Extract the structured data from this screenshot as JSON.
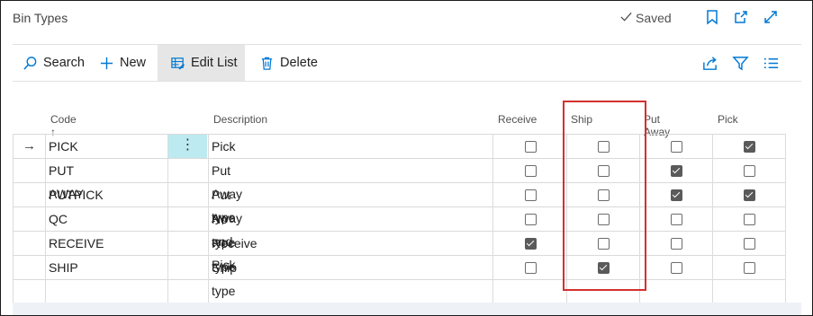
{
  "header": {
    "title": "Bin Types",
    "saved_label": "Saved"
  },
  "actions": {
    "search": "Search",
    "new": "New",
    "edit_list": "Edit List",
    "delete": "Delete"
  },
  "columns": {
    "code": "Code",
    "description": "Description",
    "receive": "Receive",
    "ship": "Ship",
    "put_away": "Put Away",
    "pick": "Pick"
  },
  "sort_indicator": "↑",
  "row_menu": "⋮",
  "current_row_marker": "→",
  "rows": [
    {
      "code": "PICK",
      "description": "Pick",
      "receive": false,
      "ship": false,
      "put_away": false,
      "pick": true
    },
    {
      "code": "PUT AWAY",
      "description": "Put Away type",
      "receive": false,
      "ship": false,
      "put_away": true,
      "pick": false
    },
    {
      "code": "PUTPICK",
      "description": "Put Away and Pick",
      "receive": false,
      "ship": false,
      "put_away": true,
      "pick": true
    },
    {
      "code": "QC",
      "description": "No type",
      "receive": false,
      "ship": false,
      "put_away": false,
      "pick": false
    },
    {
      "code": "RECEIVE",
      "description": "Receive type",
      "receive": true,
      "ship": false,
      "put_away": false,
      "pick": false
    },
    {
      "code": "SHIP",
      "description": "Ship type",
      "receive": false,
      "ship": true,
      "put_away": false,
      "pick": false
    }
  ],
  "colors": {
    "accent": "#0078d4",
    "highlight_box": "#d3302f",
    "row_menu_bg": "#bdeaf0"
  }
}
